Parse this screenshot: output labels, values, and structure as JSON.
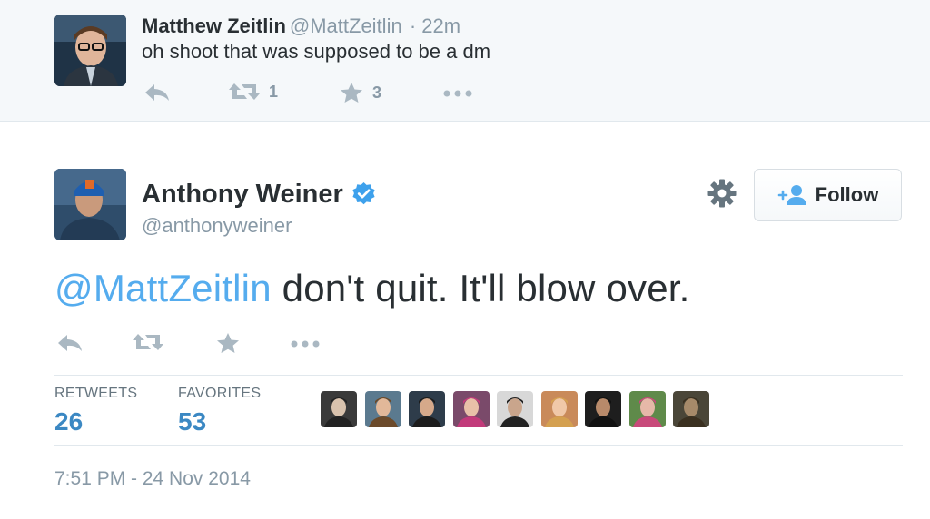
{
  "parent_tweet": {
    "name": "Matthew Zeitlin",
    "handle": "@MattZeitlin",
    "time": "· 22m",
    "text": "oh shoot that was supposed to be a dm",
    "retweet_count": "1",
    "favorite_count": "3",
    "avatar_icon": "avatar-photo"
  },
  "main_tweet": {
    "name": "Anthony Weiner",
    "handle": "@anthonyweiner",
    "verified_icon": "verified-badge-icon",
    "follow_label": "Follow",
    "mention": "@MattZeitlin",
    "text": " don't quit.  It'll blow over.",
    "stats": {
      "retweets_label": "RETWEETS",
      "retweets_value": "26",
      "favorites_label": "FAVORITES",
      "favorites_value": "53"
    },
    "favoriter_avatars": 9,
    "timestamp": "7:51 PM - 24 Nov 2014"
  },
  "colors": {
    "link": "#55acee",
    "stat_number": "#3b88c3",
    "muted": "#8899a6",
    "icon": "#aab8c2",
    "reply_bg": "#f5f8fa"
  }
}
